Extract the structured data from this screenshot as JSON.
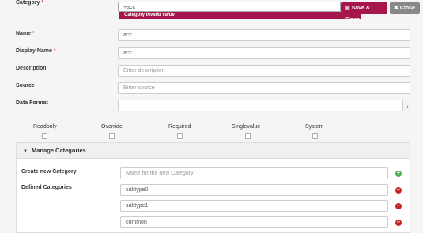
{
  "category": {
    "label": "Category",
    "value": "+acc",
    "error": {
      "prefix": "Category",
      "message": "invalid value"
    }
  },
  "buttons": {
    "save": "Save & Close",
    "close": "Close"
  },
  "name": {
    "label": "Name",
    "value": "acc"
  },
  "display_name": {
    "label": "Display Name",
    "value": "acc"
  },
  "description": {
    "label": "Description",
    "placeholder": "Enter description"
  },
  "source": {
    "label": "Source",
    "placeholder": "Enter source"
  },
  "data_format": {
    "label": "Data Format"
  },
  "flags": [
    "Readonly",
    "Override",
    "Required",
    "Singlevalue",
    "System"
  ],
  "manage": {
    "title": "Manage Categories",
    "create_label": "Create new Category",
    "create_placeholder": "Name for the new Category",
    "defined_label": "Defined Categories",
    "defined": [
      "subtype0",
      "subtype1",
      "common"
    ]
  },
  "colors": {
    "accent": "#a5174c",
    "add": "#4caf50",
    "remove": "#c62828"
  }
}
